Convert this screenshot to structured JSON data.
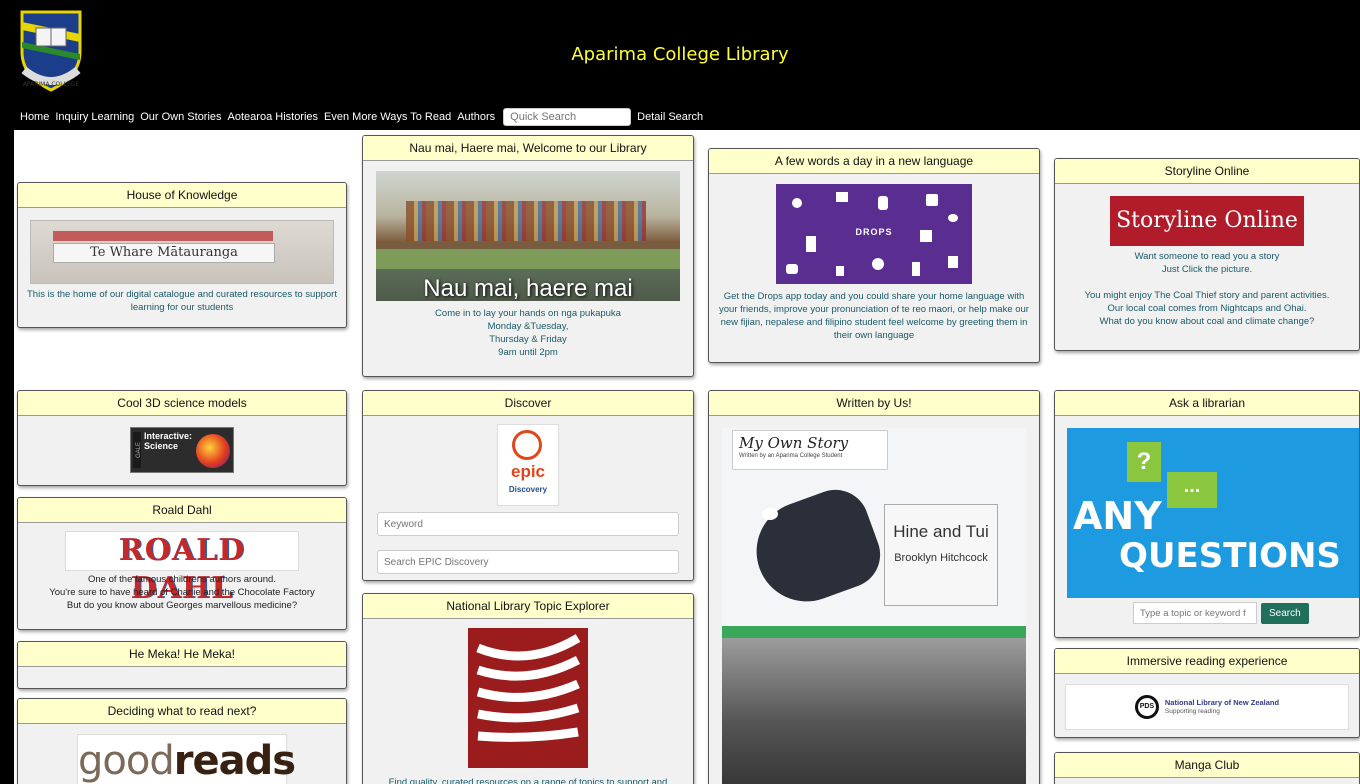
{
  "site": {
    "title": "Aparima College Library",
    "logo_text": "APARIMA COLLEGE"
  },
  "nav": {
    "items": [
      "Home",
      "Inquiry Learning",
      "Our Own Stories",
      "Aotearoa Histories",
      "Even More Ways To Read",
      "Authors"
    ],
    "search_placeholder": "Quick Search",
    "detail_search": "Detail Search"
  },
  "cards": {
    "house": {
      "title": "House of Knowledge",
      "image_text": "Te Whare Mātauranga",
      "desc": "This is the home of our digital catalogue and curated resources to support learning for our students"
    },
    "welcome": {
      "title": "Nau mai, Haere mai, Welcome to our Library",
      "image_text": "Nau mai, haere mai",
      "desc": "Come in to lay your hands on nga pukapuka\nMonday &Tuesday,\nThursday & Friday\n9am until 2pm"
    },
    "drops": {
      "title": "A few words a day in a new language",
      "image_text": "DROPS",
      "desc": "Get the Drops app today and you could share your home language with your friends, improve your pronunciation of te reo maori, or help make our new fijian, nepalese and filipino student feel welcome by greeting them in their own language"
    },
    "storyline": {
      "title": "Storyline Online",
      "image_text": "Storyline Online",
      "desc": "Want someone to read you a story\nJust Click the picture.\n\nYou might enjoy The Coal Thief story and parent activities.\nOur local coal comes from Nightcaps and Ohai.\nWhat do you know about coal and climate change?"
    },
    "science": {
      "title": "Cool 3D science models",
      "image_text": "Interactive: Science",
      "gale": "GALE"
    },
    "discover": {
      "title": "Discover",
      "logo_text": "epic",
      "logo_sub": "Discovery",
      "keyword_placeholder": "Keyword",
      "search_placeholder": "Search EPIC Discovery"
    },
    "written": {
      "title": "Written by Us!",
      "book_title": "My Own Story",
      "book_sub": "Written by an Aparima College Student",
      "story_title": "Hine and Tui",
      "author": "Brooklyn Hitchcock"
    },
    "ask": {
      "title": "Ask a librarian",
      "image_text_1": "ANY",
      "image_text_2": "QUESTIONS",
      "input_placeholder": "Type a topic or keyword f",
      "button": "Search"
    },
    "dahl": {
      "title": "Roald Dahl",
      "image_text": "ROALD DAHL",
      "desc": "One of the famous childrens authors around.\nYou're sure to have heard of Charlie and the Chocolate Factory\nBut do you know about Georges marvellous medicine?"
    },
    "topic": {
      "title": "National Library Topic Explorer",
      "desc": "Find quality, curated resources on a range of topics to support and"
    },
    "immersive": {
      "title": "Immersive reading experience",
      "logo_text": "PDS",
      "org": "National Library of New Zealand",
      "org_sub": "Supporting reading"
    },
    "meka": {
      "title": "He Meka! He Meka!"
    },
    "deciding": {
      "title": "Deciding what to read next?",
      "image_text_light": "good",
      "image_text_bold": "reads"
    },
    "manga": {
      "title": "Manga Club"
    }
  },
  "colors": {
    "title": "#ffff33",
    "header_bg": "#ffffcc",
    "button": "#1f6f5a",
    "storyline_red": "#b01c2a",
    "drops_purple": "#5a2d91",
    "ask_blue": "#1e9be0",
    "topic_red": "#9b1c1c"
  }
}
